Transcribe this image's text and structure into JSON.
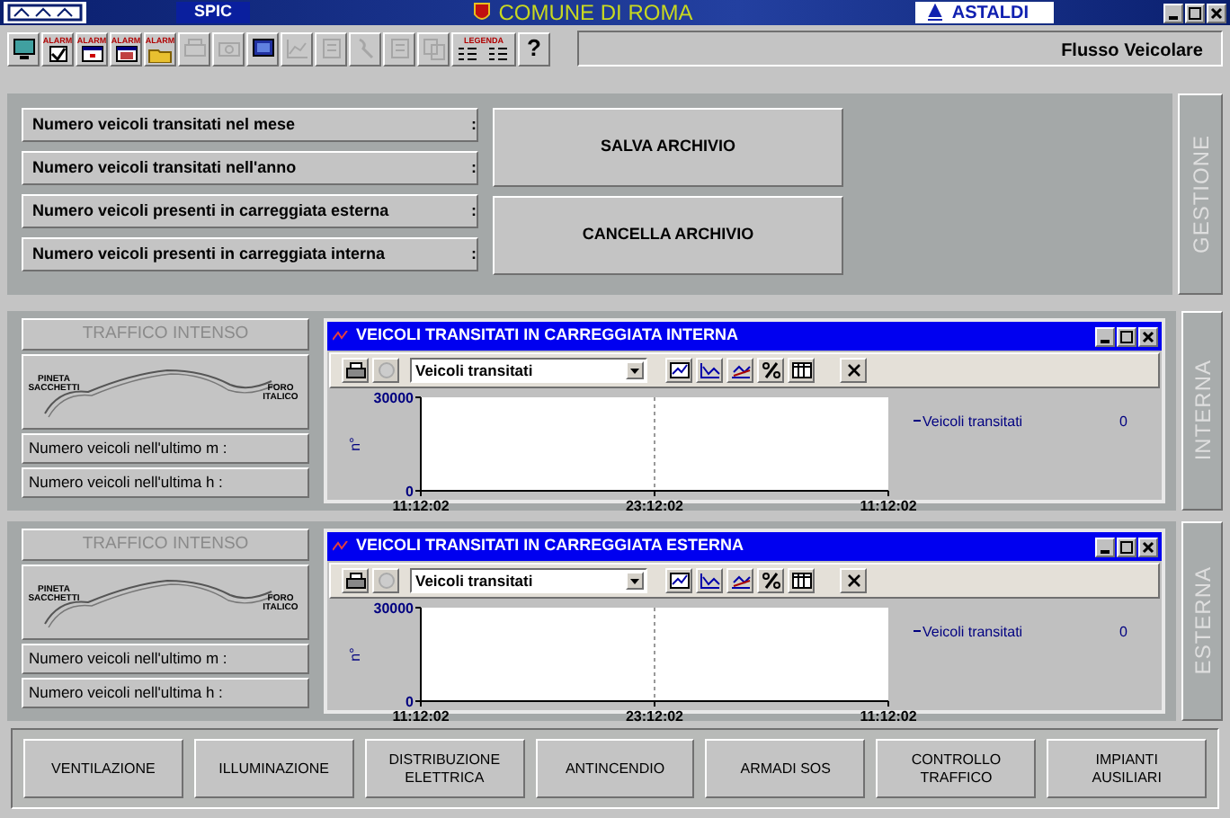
{
  "title_bar": {
    "badge": "SPIC",
    "title": "COMUNE DI ROMA",
    "brand": "ASTALDI"
  },
  "toolbar": {
    "buttons": [
      {
        "kind": "monitor",
        "disabled": false
      },
      {
        "kind": "check",
        "label": "ALARM",
        "disabled": false
      },
      {
        "kind": "window",
        "label": "ALARM",
        "disabled": false
      },
      {
        "kind": "window-red",
        "label": "ALARM",
        "disabled": false
      },
      {
        "kind": "folder",
        "label": "ALARM",
        "disabled": false
      },
      {
        "kind": "printer",
        "disabled": true
      },
      {
        "kind": "camera",
        "disabled": true
      },
      {
        "kind": "monitor-blue",
        "disabled": false
      },
      {
        "kind": "chart",
        "disabled": true
      },
      {
        "kind": "doc",
        "disabled": true
      },
      {
        "kind": "tool",
        "disabled": true
      },
      {
        "kind": "doc",
        "disabled": true
      },
      {
        "kind": "copy",
        "disabled": true
      },
      {
        "kind": "legend",
        "label": "LEGENDA",
        "disabled": false
      },
      {
        "kind": "help",
        "label": "?",
        "disabled": false
      }
    ],
    "status": "Flusso Veicolare"
  },
  "gestione": {
    "side_label": "GESTIONE",
    "fields": [
      {
        "label": "Numero veicoli transitati nel mese",
        "separator": ":"
      },
      {
        "label": "Numero veicoli transitati nell'anno",
        "separator": ":"
      },
      {
        "label": "Numero veicoli presenti in carreggiata esterna",
        "separator": ":"
      },
      {
        "label": "Numero veicoli presenti in carreggiata interna",
        "separator": ":"
      }
    ],
    "buttons": [
      "SALVA ARCHIVIO",
      "CANCELLA ARCHIVIO"
    ]
  },
  "sections": [
    {
      "side_label": "INTERNA",
      "status": "TRAFFICO INTENSO",
      "map_labels": [
        "PINETA SACCHETTI",
        "FORO ITALICO"
      ],
      "counters": [
        "Numero veicoli nell'ultimo m :",
        "Numero veicoli nell'ultima h  :"
      ],
      "window": {
        "title": "VEICOLI TRANSITATI IN CARREGGIATA INTERNA",
        "dropdown": "Veicoli transitati",
        "chart": {
          "y_label": "n°",
          "y_ticks": [
            "30000",
            "0"
          ],
          "x_labels": [
            "11:12:02",
            "23:12:02",
            "11:12:02"
          ],
          "legend_label": "Veicoli transitati",
          "legend_value": "0"
        }
      }
    },
    {
      "side_label": "ESTERNA",
      "status": "TRAFFICO INTENSO",
      "map_labels": [
        "PINETA SACCHETTI",
        "FORO ITALICO"
      ],
      "counters": [
        "Numero veicoli nell'ultimo m :",
        "Numero veicoli nell'ultima h  :"
      ],
      "window": {
        "title": "VEICOLI TRANSITATI IN CARREGGIATA ESTERNA",
        "dropdown": "Veicoli transitati",
        "chart": {
          "y_label": "n°",
          "y_ticks": [
            "30000",
            "0"
          ],
          "x_labels": [
            "11:12:02",
            "23:12:02",
            "11:12:02"
          ],
          "legend_label": "Veicoli transitati",
          "legend_value": "0"
        }
      }
    }
  ],
  "bottom_buttons": [
    "VENTILAZIONE",
    "ILLUMINAZIONE",
    "DISTRIBUZIONE ELETTRICA",
    "ANTINCENDIO",
    "ARMADI SOS",
    "CONTROLLO TRAFFICO",
    "IMPIANTI AUSILIARI"
  ]
}
